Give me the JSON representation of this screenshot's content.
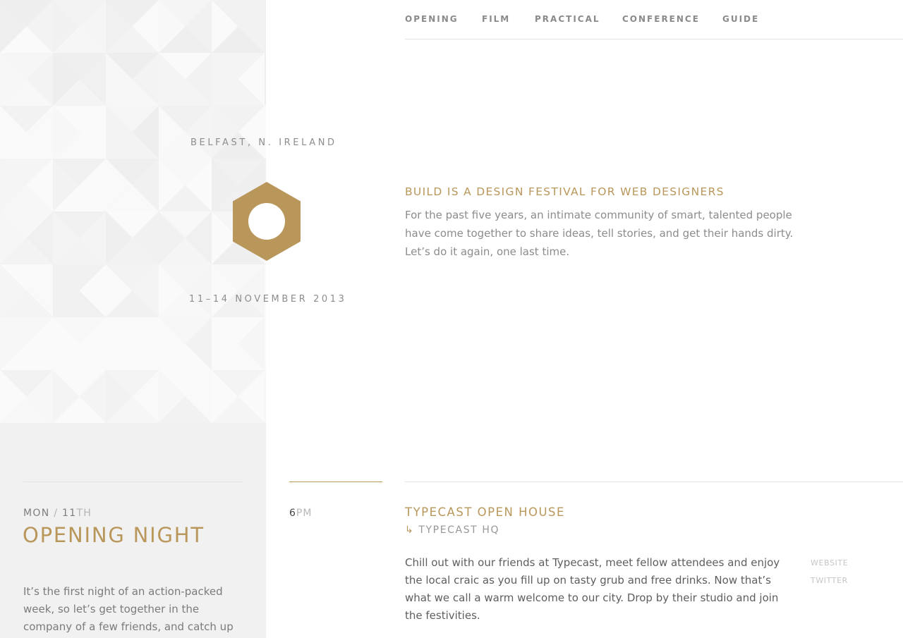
{
  "nav": {
    "items": [
      {
        "label": "OPENING"
      },
      {
        "label": "FILM"
      },
      {
        "label": "PRACTICAL"
      },
      {
        "label": "CONFERENCE"
      },
      {
        "label": "GUIDE"
      }
    ]
  },
  "hero": {
    "location": "BELFAST, N. IRELAND",
    "dates": "11–14 NOVEMBER 2013",
    "title": "BUILD IS A DESIGN FESTIVAL FOR WEB DESIGNERS",
    "text": "For the past five years, an intimate community of smart, talented people have come together to share ideas, tell stories, and get their hands dirty. Let’s do it again, one last time."
  },
  "day": {
    "weekday": "MON",
    "separator": " / ",
    "date_number": "11",
    "date_suffix": "TH",
    "title": "OPENING NIGHT",
    "text": "It’s the first night of an action-packed week, so let’s get together in the company of a few friends, and catch up"
  },
  "event": {
    "time_hour": "6",
    "time_ampm": "PM",
    "title": "TYPECAST OPEN HOUSE",
    "venue_arrow": "↳",
    "venue": "TYPECAST HQ",
    "text": "Chill out with our friends at Typecast, meet fellow attendees and enjoy the local craic as you fill up on tasty grub and free drinks. Now that’s what we call a warm welcome to our city. Drop by their studio and join the festivities.",
    "links": {
      "website": "WEBSITE",
      "twitter": "TWITTER"
    }
  },
  "colors": {
    "accent": "#b9975b",
    "sidebar_bg": "#f1f1f1"
  },
  "icons": {
    "logo": "hexagon-logo-icon"
  }
}
